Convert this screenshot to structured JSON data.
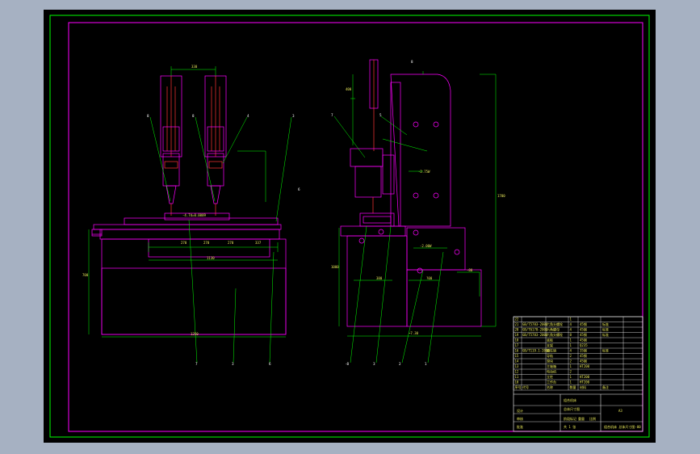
{
  "colors": {
    "background": "#a6b1c2",
    "viewport": "#000000",
    "frame": "#ff00ff",
    "outer_frame": "#00ff00",
    "geometry": "#ff00ff",
    "dimension": "#00ff00",
    "detail": "#ff3333",
    "text": "#e8e85a",
    "white": "#ffffff"
  },
  "front_view": {
    "top_dim": "330",
    "label_center": "-4.7d=0.0009",
    "bottom_dims": [
      "270",
      "270",
      "270",
      "337"
    ],
    "overall_width": "1250",
    "lower_dim": "1130",
    "height_dim": "700",
    "leader_labels_top": [
      "8",
      "8",
      "4",
      "3"
    ],
    "leader_labels_bottom": [
      "7",
      "3",
      "6"
    ],
    "mid_label": "6"
  },
  "side_view": {
    "top_label": "8",
    "labels_left": [
      "7",
      "5"
    ],
    "callouts": [
      "-2.75W",
      "-2.00W"
    ],
    "bottom_dims": [
      "380",
      "?00",
      "-80"
    ],
    "width_dim": "~7.30",
    "height_dims": [
      "1700",
      "1000",
      "400"
    ],
    "leader_labels_bottom": [
      "-8",
      "3",
      "2",
      "1"
    ]
  },
  "title_block": {
    "rows": [
      {
        "no": "22",
        "code": "",
        "name": "",
        "qty": "1",
        "mat": "",
        "note": ""
      },
      {
        "no": "21",
        "code": "GB/T5783-2000",
        "name": "六角头螺栓",
        "qty": "4",
        "mat": "45钢",
        "note": "标准"
      },
      {
        "no": "20",
        "code": "GB/T6170-2000",
        "name": "六角螺母",
        "qty": "4",
        "mat": "45钢",
        "note": "标准"
      },
      {
        "no": "19",
        "code": "GB/T5783-2000",
        "name": "六角头螺栓",
        "qty": "8",
        "mat": "45钢",
        "note": "标准"
      },
      {
        "no": "18",
        "code": "",
        "name": "底板",
        "qty": "1",
        "mat": "45钢",
        "note": ""
      },
      {
        "no": "17",
        "code": "",
        "name": "支架",
        "qty": "1",
        "mat": "Q235",
        "note": ""
      },
      {
        "no": "16",
        "code": "GB/T119.1-2000",
        "name": "圆柱销",
        "qty": "4",
        "mat": "35钢",
        "note": "标准"
      },
      {
        "no": "15",
        "code": "",
        "name": "导轨",
        "qty": "2",
        "mat": "45钢",
        "note": ""
      },
      {
        "no": "14",
        "code": "",
        "name": "滑块",
        "qty": "2",
        "mat": "45钢",
        "note": ""
      },
      {
        "no": "13",
        "code": "",
        "name": "主轴箱",
        "qty": "1",
        "mat": "HT200",
        "note": ""
      },
      {
        "no": "12",
        "code": "",
        "name": "电动机",
        "qty": "2",
        "mat": "",
        "note": ""
      },
      {
        "no": "11",
        "code": "",
        "name": "立柱",
        "qty": "1",
        "mat": "HT200",
        "note": ""
      },
      {
        "no": "10",
        "code": "",
        "name": "工作台",
        "qty": "1",
        "mat": "HT200",
        "note": ""
      }
    ],
    "header": [
      "序号",
      "代号",
      "名称",
      "数量",
      "材料",
      "备注"
    ],
    "drawing_title": [
      "组合机床",
      "总体尺寸图"
    ],
    "scale": "A3",
    "drawing_no": "组合机床 总体尺寸图-00",
    "sign_labels": [
      "设计",
      "审核",
      "批准"
    ],
    "stage_labels": [
      "阶段标记",
      "重量",
      "比例"
    ],
    "sheet": "共 1 张"
  }
}
